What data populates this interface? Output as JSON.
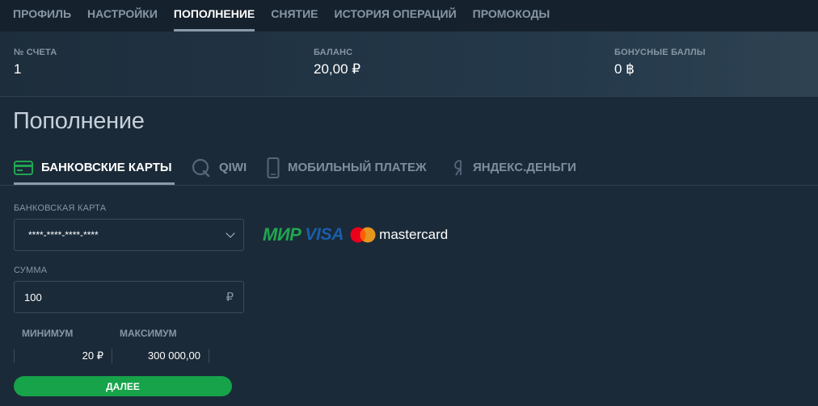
{
  "nav": {
    "tabs": [
      "ПРОФИЛЬ",
      "НАСТРОЙКИ",
      "ПОПОЛНЕНИЕ",
      "СНЯТИЕ",
      "ИСТОРИЯ ОПЕРАЦИЙ",
      "ПРОМОКОДЫ"
    ],
    "active": "ПОПОЛНЕНИЕ"
  },
  "account": {
    "number_label": "№ СЧЕТА",
    "number_value": "1",
    "balance_label": "БАЛАНС",
    "balance_value": "20,00 ₽",
    "bonus_label": "БОНУСНЫЕ БАЛЛЫ",
    "bonus_value": "0 ฿"
  },
  "page": {
    "title": "Пополнение"
  },
  "methods": [
    {
      "label": "БАНКОВСКИЕ КАРТЫ",
      "icon": "bank-card-icon",
      "active": true
    },
    {
      "label": "QIWI",
      "icon": "qiwi-icon",
      "active": false
    },
    {
      "label": "МОБИЛЬНЫЙ ПЛАТЕЖ",
      "icon": "mobile-phone-icon",
      "active": false
    },
    {
      "label": "ЯНДЕКС.ДЕНЬГИ",
      "icon": "yandex-money-icon",
      "active": false
    }
  ],
  "form": {
    "card_label": "БАНКОВСКАЯ КАРТА",
    "card_value": "****-****-****-****",
    "amount_label": "СУММА",
    "amount_value": "100",
    "currency": "₽",
    "min_label": "МИНИМУМ",
    "min_value": "20 ₽",
    "max_label": "МАКСИМУМ",
    "max_value": "300 000,00",
    "submit_label": "ДАЛЕЕ"
  },
  "logos": {
    "mir": "МИР",
    "visa": "VISA",
    "mastercard": "mastercard"
  },
  "colors": {
    "accent_green": "#16a34a",
    "background": "#1b2a38",
    "mir_green": "#1fa651",
    "visa_blue": "#1a5ea8",
    "mc_red": "#eb001b",
    "mc_orange": "#f79e1b"
  }
}
